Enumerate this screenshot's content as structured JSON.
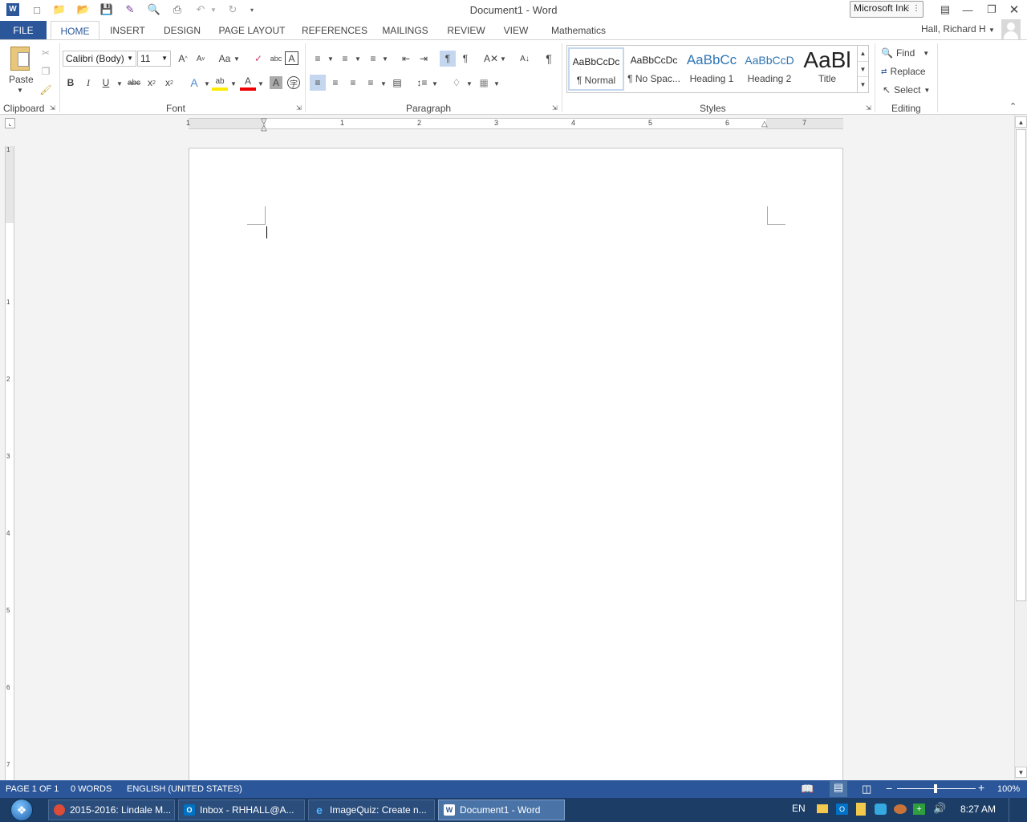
{
  "titlebar": {
    "title": "Document1 - Word",
    "ink_label": "Microsoft Ink"
  },
  "tabs": [
    {
      "label": "FILE"
    },
    {
      "label": "HOME"
    },
    {
      "label": "INSERT"
    },
    {
      "label": "DESIGN"
    },
    {
      "label": "PAGE LAYOUT"
    },
    {
      "label": "REFERENCES"
    },
    {
      "label": "MAILINGS"
    },
    {
      "label": "REVIEW"
    },
    {
      "label": "VIEW"
    },
    {
      "label": "Mathematics"
    }
  ],
  "user": {
    "name": "Hall, Richard H"
  },
  "ribbon": {
    "clipboard": {
      "label": "Clipboard",
      "paste": "Paste"
    },
    "font": {
      "label": "Font",
      "font_name": "Calibri (Body)",
      "font_size": "11"
    },
    "paragraph": {
      "label": "Paragraph"
    },
    "styles": {
      "label": "Styles",
      "items": [
        {
          "preview": "AaBbCcDc",
          "name": "¶ Normal"
        },
        {
          "preview": "AaBbCcDc",
          "name": "¶ No Spac..."
        },
        {
          "preview": "AaBbCc",
          "name": "Heading 1"
        },
        {
          "preview": "AaBbCcD",
          "name": "Heading 2"
        },
        {
          "preview": "AaBl",
          "name": "Title"
        }
      ]
    },
    "editing": {
      "label": "Editing",
      "find": "Find",
      "replace": "Replace",
      "select": "Select"
    }
  },
  "ruler": {
    "ticks": [
      "1",
      "1",
      "2",
      "3",
      "4",
      "5",
      "6",
      "7"
    ]
  },
  "vruler": {
    "ticks": [
      "1",
      "1",
      "2",
      "3",
      "4",
      "5",
      "6",
      "7"
    ]
  },
  "status": {
    "page": "PAGE 1 OF 1",
    "words": "0 WORDS",
    "language": "ENGLISH (UNITED STATES)",
    "zoom": "100%"
  },
  "taskbar": {
    "items": [
      {
        "label": "2015-2016: Lindale M...",
        "icon_color": "#dd4b39"
      },
      {
        "label": "Inbox - RHHALL@A...",
        "icon_color": "#0072c6"
      },
      {
        "label": "ImageQuiz: Create n...",
        "icon_color": "#1e90ff"
      },
      {
        "label": "Document1 - Word",
        "icon_color": "#2b579a"
      }
    ],
    "lang": "EN",
    "time": "8:27 AM"
  }
}
